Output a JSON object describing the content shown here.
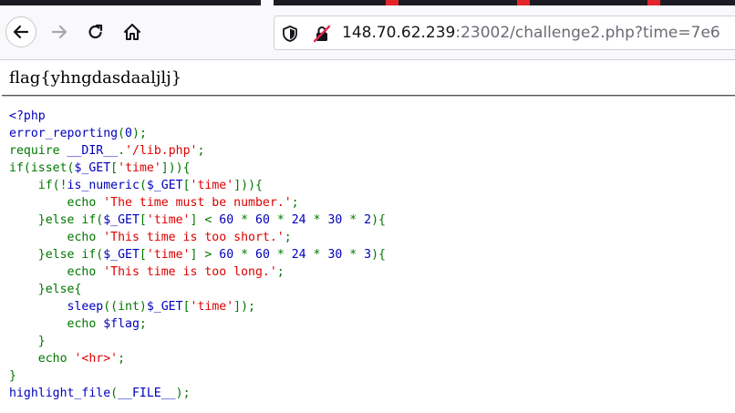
{
  "browser": {
    "url_host": "148.70.62.239",
    "url_path": ":23002/challenge2.php?time=7e6",
    "icons": [
      "back-arrow-icon",
      "forward-arrow-icon",
      "reload-icon",
      "home-icon",
      "shield-icon",
      "insecure-lock-icon"
    ]
  },
  "page": {
    "output": "flag{yhngdasdaaljlj}",
    "source_lines": [
      [
        {
          "t": "<?php",
          "c": "default"
        }
      ],
      [
        {
          "t": "error_reporting",
          "c": "default"
        },
        {
          "t": "(",
          "c": "keyword"
        },
        {
          "t": "0",
          "c": "default"
        },
        {
          "t": ");",
          "c": "keyword"
        }
      ],
      [
        {
          "t": "require ",
          "c": "keyword"
        },
        {
          "t": "__DIR__",
          "c": "default"
        },
        {
          "t": ".",
          "c": "keyword"
        },
        {
          "t": "'/lib.php'",
          "c": "string"
        },
        {
          "t": ";",
          "c": "keyword"
        }
      ],
      [
        {
          "t": "if(isset(",
          "c": "keyword"
        },
        {
          "t": "$_GET",
          "c": "default"
        },
        {
          "t": "[",
          "c": "keyword"
        },
        {
          "t": "'time'",
          "c": "string"
        },
        {
          "t": "])){",
          "c": "keyword"
        }
      ],
      [
        {
          "t": "    if(!",
          "c": "keyword"
        },
        {
          "t": "is_numeric",
          "c": "default"
        },
        {
          "t": "(",
          "c": "keyword"
        },
        {
          "t": "$_GET",
          "c": "default"
        },
        {
          "t": "[",
          "c": "keyword"
        },
        {
          "t": "'time'",
          "c": "string"
        },
        {
          "t": "])){",
          "c": "keyword"
        }
      ],
      [
        {
          "t": "        echo ",
          "c": "keyword"
        },
        {
          "t": "'The time must be number.'",
          "c": "string"
        },
        {
          "t": ";",
          "c": "keyword"
        }
      ],
      [
        {
          "t": "    }else if(",
          "c": "keyword"
        },
        {
          "t": "$_GET",
          "c": "default"
        },
        {
          "t": "[",
          "c": "keyword"
        },
        {
          "t": "'time'",
          "c": "string"
        },
        {
          "t": "] < ",
          "c": "keyword"
        },
        {
          "t": "60 ",
          "c": "default"
        },
        {
          "t": "* ",
          "c": "keyword"
        },
        {
          "t": "60 ",
          "c": "default"
        },
        {
          "t": "* ",
          "c": "keyword"
        },
        {
          "t": "24 ",
          "c": "default"
        },
        {
          "t": "* ",
          "c": "keyword"
        },
        {
          "t": "30 ",
          "c": "default"
        },
        {
          "t": "* ",
          "c": "keyword"
        },
        {
          "t": "2",
          "c": "default"
        },
        {
          "t": "){",
          "c": "keyword"
        }
      ],
      [
        {
          "t": "        echo ",
          "c": "keyword"
        },
        {
          "t": "'This time is too short.'",
          "c": "string"
        },
        {
          "t": ";",
          "c": "keyword"
        }
      ],
      [
        {
          "t": "    }else if(",
          "c": "keyword"
        },
        {
          "t": "$_GET",
          "c": "default"
        },
        {
          "t": "[",
          "c": "keyword"
        },
        {
          "t": "'time'",
          "c": "string"
        },
        {
          "t": "] > ",
          "c": "keyword"
        },
        {
          "t": "60 ",
          "c": "default"
        },
        {
          "t": "* ",
          "c": "keyword"
        },
        {
          "t": "60 ",
          "c": "default"
        },
        {
          "t": "* ",
          "c": "keyword"
        },
        {
          "t": "24 ",
          "c": "default"
        },
        {
          "t": "* ",
          "c": "keyword"
        },
        {
          "t": "30 ",
          "c": "default"
        },
        {
          "t": "* ",
          "c": "keyword"
        },
        {
          "t": "3",
          "c": "default"
        },
        {
          "t": "){",
          "c": "keyword"
        }
      ],
      [
        {
          "t": "        echo ",
          "c": "keyword"
        },
        {
          "t": "'This time is too long.'",
          "c": "string"
        },
        {
          "t": ";",
          "c": "keyword"
        }
      ],
      [
        {
          "t": "    }else{",
          "c": "keyword"
        }
      ],
      [
        {
          "t": "        sleep",
          "c": "default"
        },
        {
          "t": "((int)",
          "c": "keyword"
        },
        {
          "t": "$_GET",
          "c": "default"
        },
        {
          "t": "[",
          "c": "keyword"
        },
        {
          "t": "'time'",
          "c": "string"
        },
        {
          "t": "]);",
          "c": "keyword"
        }
      ],
      [
        {
          "t": "        echo ",
          "c": "keyword"
        },
        {
          "t": "$flag",
          "c": "default"
        },
        {
          "t": ";",
          "c": "keyword"
        }
      ],
      [
        {
          "t": "    }",
          "c": "keyword"
        }
      ],
      [
        {
          "t": "    echo ",
          "c": "keyword"
        },
        {
          "t": "'<hr>'",
          "c": "string"
        },
        {
          "t": ";",
          "c": "keyword"
        }
      ],
      [
        {
          "t": "}",
          "c": "keyword"
        }
      ],
      [
        {
          "t": "highlight_file",
          "c": "default"
        },
        {
          "t": "(",
          "c": "keyword"
        },
        {
          "t": "__FILE__",
          "c": "default"
        },
        {
          "t": ");",
          "c": "keyword"
        }
      ]
    ]
  }
}
